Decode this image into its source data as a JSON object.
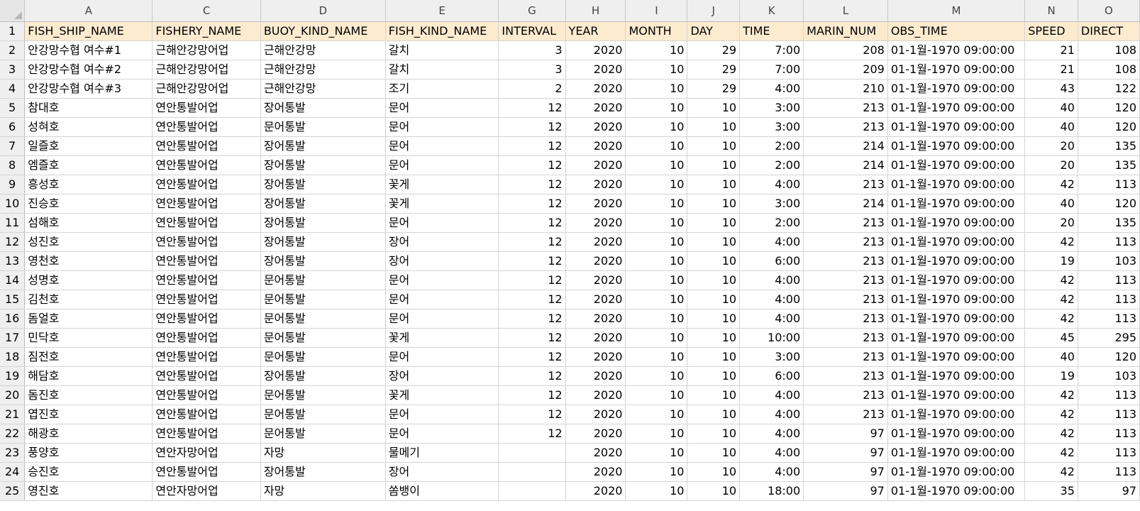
{
  "column_letters": [
    "A",
    "C",
    "D",
    "E",
    "G",
    "H",
    "I",
    "J",
    "K",
    "L",
    "M",
    "N",
    "O"
  ],
  "colors": {
    "header_fill": "#fdebd0",
    "grid": "#d4d4d4",
    "row_header_bg": "#efefef"
  },
  "rows": [
    {
      "n": "1",
      "cells": [
        "FISH_SHIP_NAME",
        "FISHERY_NAME",
        "BUOY_KIND_NAME",
        "FISH_KIND_NAME",
        "INTERVAL",
        "YEAR",
        "MONTH",
        "DAY",
        "TIME",
        "MARIN_NUM",
        "OBS_TIME",
        "SPEED",
        "DIRECT"
      ]
    },
    {
      "n": "2",
      "cells": [
        "안강망수협 여수#1",
        "근해안강망어업",
        "근해안강망",
        "갈치",
        "3",
        "2020",
        "10",
        "29",
        "7:00",
        "208",
        "01-1월-1970 09:00:00",
        "21",
        "108"
      ]
    },
    {
      "n": "3",
      "cells": [
        "안강망수협 여수#2",
        "근해안강망어업",
        "근해안강망",
        "갈치",
        "3",
        "2020",
        "10",
        "29",
        "7:00",
        "209",
        "01-1월-1970 09:00:00",
        "21",
        "108"
      ]
    },
    {
      "n": "4",
      "cells": [
        "안강망수협 여수#3",
        "근해안강망어업",
        "근해안강망",
        "조기",
        "2",
        "2020",
        "10",
        "29",
        "4:00",
        "210",
        "01-1월-1970 09:00:00",
        "43",
        "122"
      ]
    },
    {
      "n": "5",
      "cells": [
        "참대호",
        "연안통발어업",
        "장어통발",
        "문어",
        "12",
        "2020",
        "10",
        "10",
        "3:00",
        "213",
        "01-1월-1970 09:00:00",
        "40",
        "120"
      ]
    },
    {
      "n": "6",
      "cells": [
        "성혀호",
        "연안통발어업",
        "문어통발",
        "문어",
        "12",
        "2020",
        "10",
        "10",
        "3:00",
        "213",
        "01-1월-1970 09:00:00",
        "40",
        "120"
      ]
    },
    {
      "n": "7",
      "cells": [
        "일즐호",
        "연안통발어업",
        "장어통발",
        "문어",
        "12",
        "2020",
        "10",
        "10",
        "2:00",
        "214",
        "01-1월-1970 09:00:00",
        "20",
        "135"
      ]
    },
    {
      "n": "8",
      "cells": [
        "엠즐호",
        "연안통발어업",
        "장어통발",
        "문어",
        "12",
        "2020",
        "10",
        "10",
        "2:00",
        "214",
        "01-1월-1970 09:00:00",
        "20",
        "135"
      ]
    },
    {
      "n": "9",
      "cells": [
        "흥성호",
        "연안통발어업",
        "장어통발",
        "꽃게",
        "12",
        "2020",
        "10",
        "10",
        "4:00",
        "213",
        "01-1월-1970 09:00:00",
        "42",
        "113"
      ]
    },
    {
      "n": "10",
      "cells": [
        "진승호",
        "연안통발어업",
        "장어통발",
        "꽃게",
        "12",
        "2020",
        "10",
        "10",
        "3:00",
        "214",
        "01-1월-1970 09:00:00",
        "40",
        "120"
      ]
    },
    {
      "n": "11",
      "cells": [
        "섬해호",
        "연안통발어업",
        "장어통발",
        "문어",
        "12",
        "2020",
        "10",
        "10",
        "2:00",
        "213",
        "01-1월-1970 09:00:00",
        "20",
        "135"
      ]
    },
    {
      "n": "12",
      "cells": [
        "성진호",
        "연안통발어업",
        "장어통발",
        "장어",
        "12",
        "2020",
        "10",
        "10",
        "4:00",
        "213",
        "01-1월-1970 09:00:00",
        "42",
        "113"
      ]
    },
    {
      "n": "13",
      "cells": [
        "영천호",
        "연안통발어업",
        "장어통발",
        "장어",
        "12",
        "2020",
        "10",
        "10",
        "6:00",
        "213",
        "01-1월-1970 09:00:00",
        "19",
        "103"
      ]
    },
    {
      "n": "14",
      "cells": [
        "성명호",
        "연안통발어업",
        "문어통발",
        "문어",
        "12",
        "2020",
        "10",
        "10",
        "4:00",
        "213",
        "01-1월-1970 09:00:00",
        "42",
        "113"
      ]
    },
    {
      "n": "15",
      "cells": [
        "김천호",
        "연안통발어업",
        "문어통발",
        "문어",
        "12",
        "2020",
        "10",
        "10",
        "4:00",
        "213",
        "01-1월-1970 09:00:00",
        "42",
        "113"
      ]
    },
    {
      "n": "16",
      "cells": [
        "돔얼호",
        "연안통발어업",
        "문어통발",
        "문어",
        "12",
        "2020",
        "10",
        "10",
        "4:00",
        "213",
        "01-1월-1970 09:00:00",
        "42",
        "113"
      ]
    },
    {
      "n": "17",
      "cells": [
        "민닥호",
        "연안통발어업",
        "문어통발",
        "꽃게",
        "12",
        "2020",
        "10",
        "10",
        "10:00",
        "213",
        "01-1월-1970 09:00:00",
        "45",
        "295"
      ]
    },
    {
      "n": "18",
      "cells": [
        "짐전호",
        "연안통발어업",
        "문어통발",
        "문어",
        "12",
        "2020",
        "10",
        "10",
        "3:00",
        "213",
        "01-1월-1970 09:00:00",
        "40",
        "120"
      ]
    },
    {
      "n": "19",
      "cells": [
        "해담호",
        "연안통발어업",
        "장어통발",
        "장어",
        "12",
        "2020",
        "10",
        "10",
        "6:00",
        "213",
        "01-1월-1970 09:00:00",
        "19",
        "103"
      ]
    },
    {
      "n": "20",
      "cells": [
        "돔진호",
        "연안통발어업",
        "문어통발",
        "꽃게",
        "12",
        "2020",
        "10",
        "10",
        "4:00",
        "213",
        "01-1월-1970 09:00:00",
        "42",
        "113"
      ]
    },
    {
      "n": "21",
      "cells": [
        "엽진호",
        "연안통발어업",
        "문어통발",
        "문어",
        "12",
        "2020",
        "10",
        "10",
        "4:00",
        "213",
        "01-1월-1970 09:00:00",
        "42",
        "113"
      ]
    },
    {
      "n": "22",
      "cells": [
        "해광호",
        "연안통발어업",
        "문어통발",
        "문어",
        "12",
        "2020",
        "10",
        "10",
        "4:00",
        "97",
        "01-1월-1970 09:00:00",
        "42",
        "113"
      ]
    },
    {
      "n": "23",
      "cells": [
        "풍양호",
        "연안자망어업",
        "자망",
        "물메기",
        "",
        "2020",
        "10",
        "10",
        "4:00",
        "97",
        "01-1월-1970 09:00:00",
        "42",
        "113"
      ]
    },
    {
      "n": "24",
      "cells": [
        "승진호",
        "연안통발어업",
        "장어통발",
        "장어",
        "",
        "2020",
        "10",
        "10",
        "4:00",
        "97",
        "01-1월-1970 09:00:00",
        "42",
        "113"
      ]
    },
    {
      "n": "25",
      "cells": [
        "영진호",
        "연안자망어업",
        "자망",
        "쏨뱅이",
        "",
        "2020",
        "10",
        "10",
        "18:00",
        "97",
        "01-1월-1970 09:00:00",
        "35",
        "97"
      ]
    }
  ]
}
